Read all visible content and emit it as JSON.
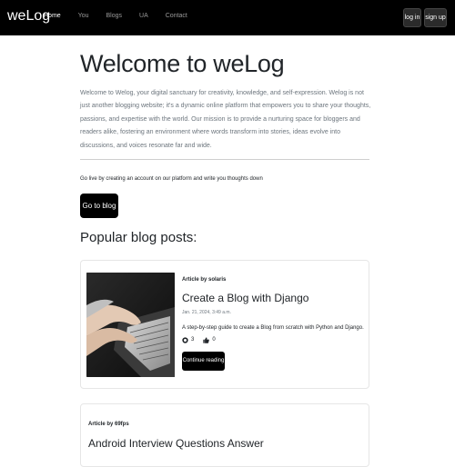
{
  "navbar": {
    "brand": "weLog",
    "links": [
      {
        "label": "Home",
        "active": true
      },
      {
        "label": "You",
        "active": false
      },
      {
        "label": "Blogs",
        "active": false
      },
      {
        "label": "UA",
        "active": false
      },
      {
        "label": "Contact",
        "active": false
      }
    ],
    "login_label": "log in",
    "signup_label": "sign up"
  },
  "hero": {
    "title": "Welcome to weLog",
    "intro": "Welcome to Welog, your digital sanctuary for creativity, knowledge, and self-expression. Welog is not just another blogging website; it's a dynamic online platform that empowers you to share your thoughts, passions, and expertise with the world. Our mission is to provide a nurturing space for bloggers and readers alike, fostering an environment where words transform into stories, ideas evolve into discussions, and voices resonate far and wide.",
    "cta_text": "Go live by creating an account on our platform and write you thoughts down",
    "cta_button": "Go to blog"
  },
  "popular": {
    "heading": "Popular blog posts:",
    "posts": [
      {
        "author": "Article by solaris",
        "title": "Create a Blog with Django",
        "date": "Jan. 21, 2024, 3:49 a.m.",
        "description": "A step-by-step guide to create a Blog from scratch with Python and Django.",
        "comments": "3",
        "likes": "0",
        "button": "Continue reading"
      },
      {
        "author": "Article by 69fps",
        "title": "Android Interview Questions Answer"
      }
    ]
  },
  "icons": {
    "comment": "comment-icon",
    "like": "thumbs-up-icon"
  },
  "colors": {
    "navbar_bg": "#000000",
    "button_bg": "#000000",
    "muted_text": "#6c757d"
  }
}
